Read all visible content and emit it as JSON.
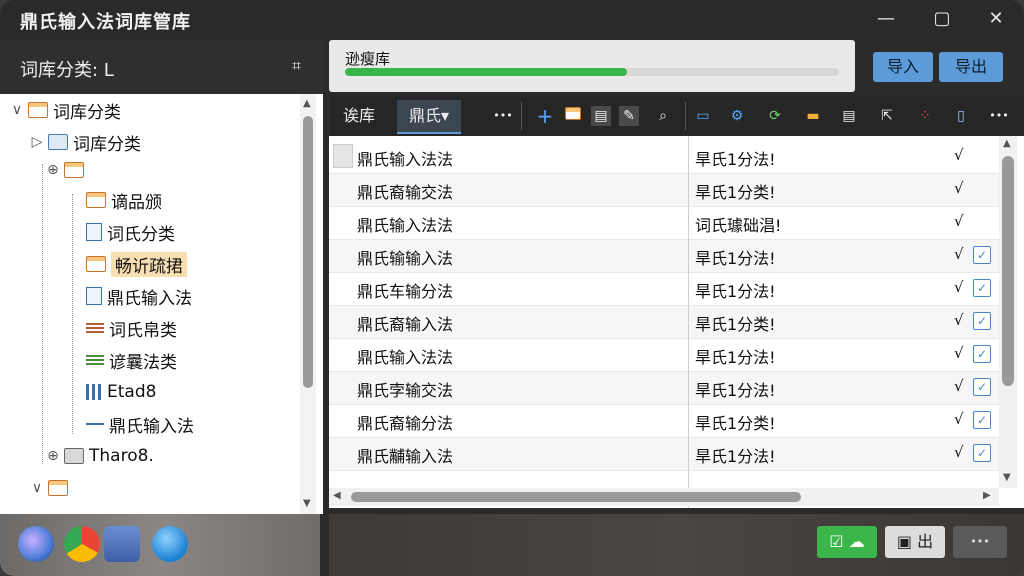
{
  "window": {
    "title": "鼎氏输入法词库管库",
    "minimize_icon": "—",
    "restore_icon": "▢",
    "close_icon": "✕"
  },
  "sidebar": {
    "header_label": "词库分类: ",
    "header_cursor": "L",
    "header_icon": "⌗",
    "tree": [
      {
        "label": "词库分类",
        "toggle": "∨"
      },
      {
        "label": "词库分类",
        "toggle": "▷"
      },
      {
        "label": "",
        "toggle": "⊕"
      },
      {
        "label": "谪品颁"
      },
      {
        "label": "词氏分类"
      },
      {
        "label": "畅䜣疏捃",
        "selected": true
      },
      {
        "label": "鼎氏输入法"
      },
      {
        "label": "词氏帛类"
      },
      {
        "label": "谚曩法类"
      },
      {
        "label": "Etad8"
      },
      {
        "label": "鼎氏输入法"
      },
      {
        "label": "Tharo8.",
        "toggle": "⊕"
      },
      {
        "label": "",
        "toggle": "∨"
      }
    ]
  },
  "progress": {
    "label": "逊瘦库",
    "percent": 57
  },
  "actions": {
    "import_label": "导入",
    "export_label": "导出"
  },
  "toolbar": {
    "tab1": "诶库",
    "tab2": "鼎氏",
    "tab2_caret": "▾",
    "more": "•••",
    "more2": "•••"
  },
  "table": {
    "rows": [
      {
        "word": "鼎氏输入法法",
        "desc": "旱氏1分法!",
        "mark": "√",
        "checked": null
      },
      {
        "word": "鼎氏裔输交法",
        "desc": "旱氏1分类!",
        "mark": "√",
        "checked": null
      },
      {
        "word": "鼎氏输入法法",
        "desc": "词氏璩础淐!",
        "mark": "√",
        "checked": null
      },
      {
        "word": "鼎氏输输入法",
        "desc": "旱氏1分法!",
        "mark": "√",
        "checked": true
      },
      {
        "word": "鼎氏车输分法",
        "desc": "旱氏1分法!",
        "mark": "√",
        "checked": true
      },
      {
        "word": "鼎氏裔输入法",
        "desc": "旱氏1分类!",
        "mark": "√",
        "checked": true
      },
      {
        "word": "鼎氏输入法法",
        "desc": "旱氏1分法!",
        "mark": "√",
        "checked": true
      },
      {
        "word": "鼎氏孛输交法",
        "desc": "旱氏1分法!",
        "mark": "√",
        "checked": true
      },
      {
        "word": "鼎氏裔输分法",
        "desc": "旱氏1分类!",
        "mark": "√",
        "checked": true
      },
      {
        "word": "鼎氏黼输入法",
        "desc": "旱氏1分法!",
        "mark": "√",
        "checked": true
      }
    ]
  },
  "bottom": {
    "more": "•••",
    "btn2_text": "出"
  },
  "colors": {
    "accent": "#5d9bd8",
    "progress": "#3bb54a",
    "selection": "#f7dfb1",
    "ok_button": "#3cb54a"
  }
}
